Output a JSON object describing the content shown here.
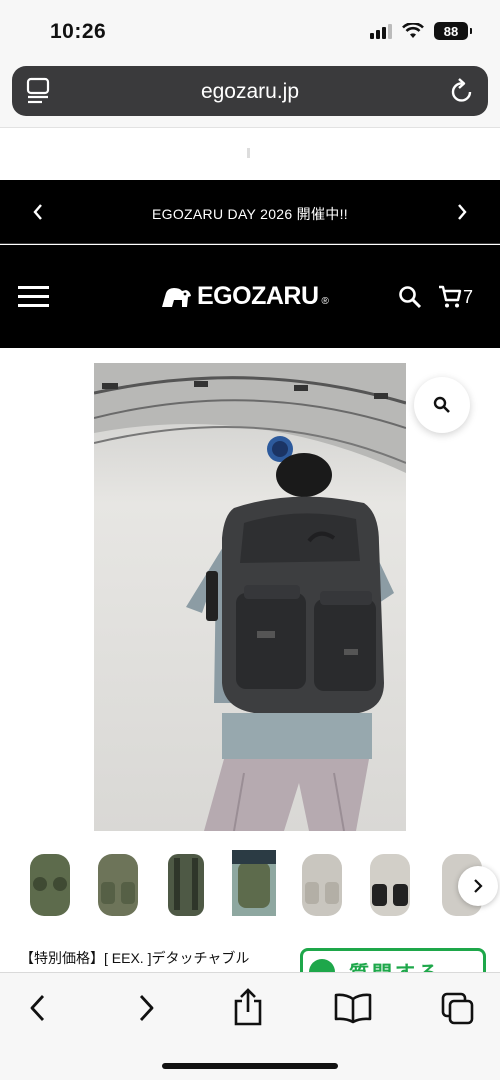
{
  "status_bar": {
    "time": "10:26",
    "battery": "88"
  },
  "browser": {
    "url": "egozaru.jp"
  },
  "announcement": {
    "text": "EGOZARU DAY 2026 開催中!!"
  },
  "header": {
    "logo_text": "EGOZARU",
    "logo_mark": "®",
    "cart_count": "7"
  },
  "product": {
    "title": "【特別価格】[ EEX. ]デタッチャブル",
    "question_label": "質問する",
    "thumbnail_count": 8
  },
  "colors": {
    "brand_black": "#000000",
    "accent_green": "#1ea74a",
    "url_bar": "#3a3a3c"
  },
  "icons": [
    "tabs-icon",
    "reload-icon",
    "chevron-left-icon",
    "chevron-right-icon",
    "menu-icon",
    "search-icon",
    "cart-icon",
    "zoom-icon",
    "share-icon",
    "bookmarks-icon",
    "tabs-overview-icon"
  ]
}
